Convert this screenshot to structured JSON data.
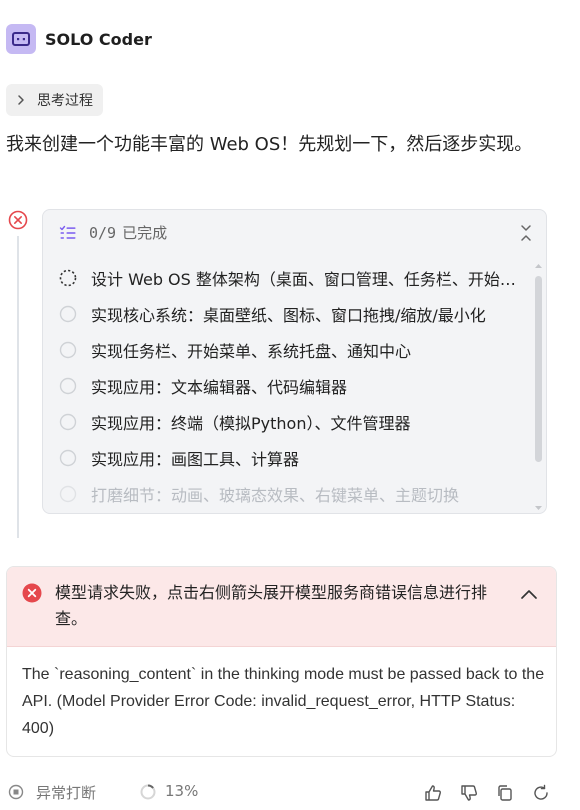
{
  "header": {
    "bot_name": "SOLO Coder"
  },
  "thinking": {
    "label": "思考过程"
  },
  "reply": {
    "text": "我来创建一个功能丰富的 Web OS！先规划一下，然后逐步实现。"
  },
  "todo": {
    "progress": "0/9",
    "status": "已完成",
    "items": [
      {
        "label": "设计 Web OS 整体架构（桌面、窗口管理、任务栏、开始菜单）",
        "state": "in-progress"
      },
      {
        "label": "实现核心系统：桌面壁纸、图标、窗口拖拽/缩放/最小化",
        "state": "pending"
      },
      {
        "label": "实现任务栏、开始菜单、系统托盘、通知中心",
        "state": "pending"
      },
      {
        "label": "实现应用：文本编辑器、代码编辑器",
        "state": "pending"
      },
      {
        "label": "实现应用：终端（模拟Python）、文件管理器",
        "state": "pending"
      },
      {
        "label": "实现应用：画图工具、计算器",
        "state": "pending"
      },
      {
        "label": "打磨细节：动画、玻璃态效果、右键菜单、主题切换",
        "state": "pending"
      }
    ]
  },
  "error": {
    "title": "模型请求失败，点击右侧箭头展开模型服务商错误信息进行排查。",
    "detail": "The `reasoning_content` in the thinking mode must be passed back to the API. (Model Provider Error Code: invalid_request_error, HTTP Status: 400)"
  },
  "footer": {
    "status": "异常打断",
    "percent": "13%"
  },
  "colors": {
    "accent": "#7b5cf0",
    "error_red": "#e5484d",
    "error_bg": "#fce8e8"
  }
}
